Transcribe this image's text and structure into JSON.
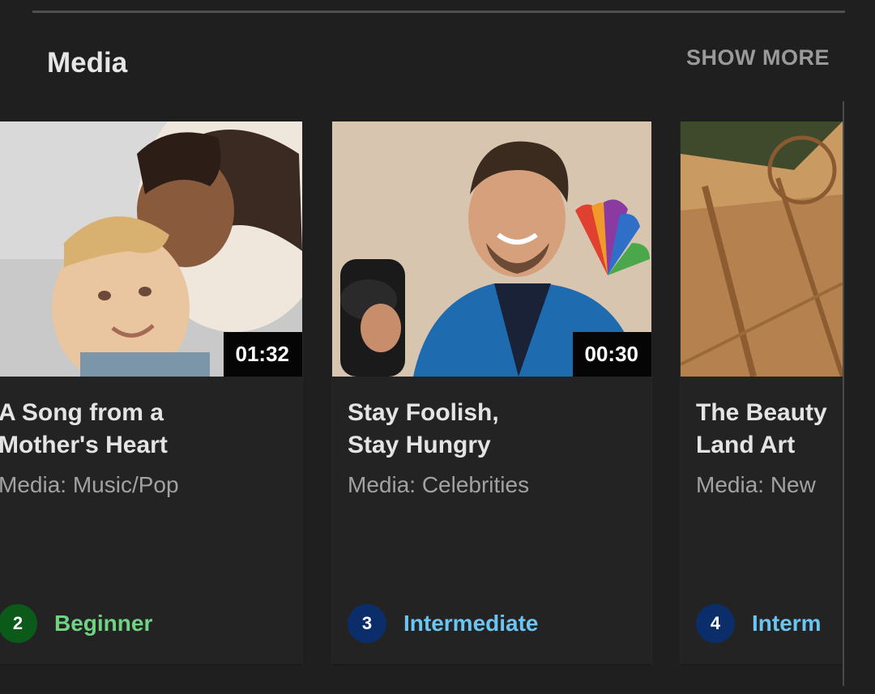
{
  "section": {
    "title": "Media",
    "show_more_label": "SHOW MORE"
  },
  "cards": [
    {
      "duration": "01:32",
      "title_line1": "A Song from a",
      "title_line2": "Mother's Heart",
      "category": "Media: Music/Pop",
      "level_number": "2",
      "level_label": "Beginner",
      "level_color": "#6fd383",
      "level_badge_color": "#0c5a1a"
    },
    {
      "duration": "00:30",
      "title_line1": "Stay Foolish,",
      "title_line2": "Stay Hungry",
      "category": "Media: Celebrities",
      "level_number": "3",
      "level_label": "Intermediate",
      "level_color": "#6cc4f2",
      "level_badge_color": "#0b2e6b"
    },
    {
      "title_line1": "The Beauty",
      "title_line2": "Land Art",
      "category": "Media: New",
      "level_number": "4",
      "level_label": "Interm",
      "level_color": "#6cc4f2",
      "level_badge_color": "#0b2e6b"
    }
  ]
}
